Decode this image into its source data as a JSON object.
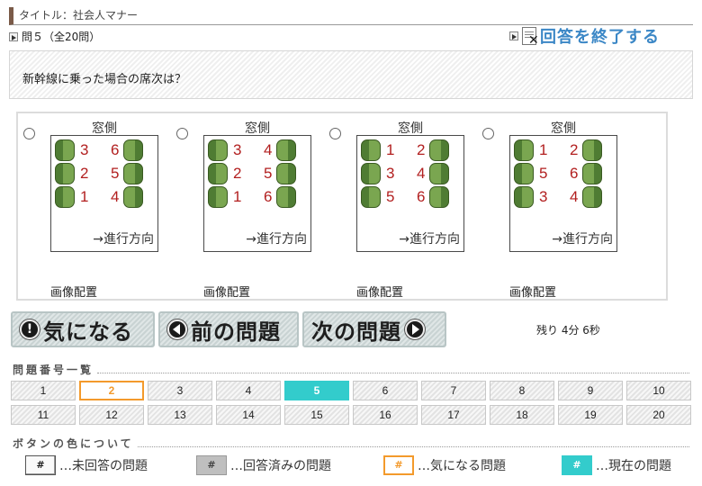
{
  "header": {
    "title": "タイトル：社会人マナー",
    "question_counter": "問５（全20問）",
    "end_label": "回答を終了する"
  },
  "question": {
    "text": "新幹線に乗った場合の席次は？"
  },
  "choices": [
    {
      "window_label": "窓側",
      "left_numbers": [
        "3",
        "2",
        "1"
      ],
      "right_numbers": [
        "6",
        "5",
        "4"
      ],
      "direction": "→進行方向",
      "caption": "画像配置"
    },
    {
      "window_label": "窓側",
      "left_numbers": [
        "3",
        "2",
        "1"
      ],
      "right_numbers": [
        "4",
        "5",
        "6"
      ],
      "direction": "→進行方向",
      "caption": "画像配置"
    },
    {
      "window_label": "窓側",
      "left_numbers": [
        "1",
        "3",
        "5"
      ],
      "right_numbers": [
        "2",
        "4",
        "6"
      ],
      "direction": "→進行方向",
      "caption": "画像配置"
    },
    {
      "window_label": "窓側",
      "left_numbers": [
        "1",
        "5",
        "3"
      ],
      "right_numbers": [
        "2",
        "6",
        "4"
      ],
      "direction": "→進行方向",
      "caption": "画像配置"
    }
  ],
  "nav": {
    "flag_label": "気になる",
    "prev_label": "前の問題",
    "next_label": "次の問題",
    "flag_glyph": "!",
    "timer": "残り 4分 6秒"
  },
  "question_list": {
    "heading": "問題番号一覧",
    "items": [
      "1",
      "2",
      "3",
      "4",
      "5",
      "6",
      "7",
      "8",
      "9",
      "10",
      "11",
      "12",
      "13",
      "14",
      "15",
      "16",
      "17",
      "18",
      "19",
      "20"
    ],
    "flagged": "2",
    "current": "5"
  },
  "legend": {
    "heading": "ボタンの色について",
    "swatch_glyph": "#",
    "unanswered": "…未回答の問題",
    "answered": "…回答済みの問題",
    "flagged": "…気になる問題",
    "current": "…現在の問題"
  },
  "colors": {
    "accent_blue": "#3b87c6",
    "flag_orange": "#f39a2c",
    "current_teal": "#33cccc",
    "seat_green": "#7aa650",
    "seat_number_red": "#b21f1f"
  }
}
